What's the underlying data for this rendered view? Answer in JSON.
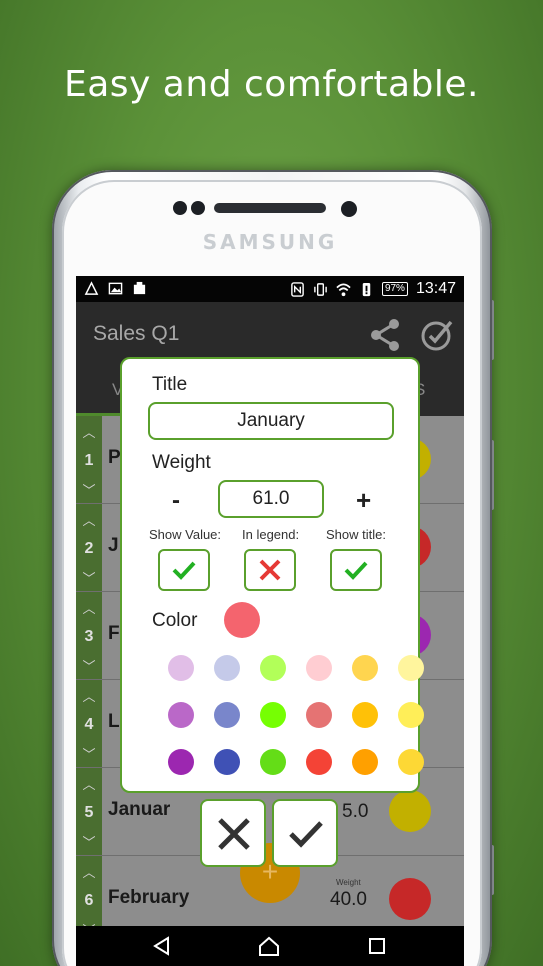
{
  "headline": "Easy and comfortable.",
  "device": {
    "brand": "SAMSUNG"
  },
  "statusbar": {
    "battery": "97%",
    "time": "13:47"
  },
  "appbar": {
    "title": "Sales Q1",
    "icons": [
      "share-icon",
      "target-check-icon"
    ]
  },
  "tabs": {
    "first_partial": "V",
    "second_partial": "S"
  },
  "list": {
    "weight_label": "Weight",
    "rows": [
      {
        "index": "1",
        "name": "P",
        "weight": "",
        "color": "#c2b000"
      },
      {
        "index": "2",
        "name": "J",
        "weight": "",
        "color": "#c62828"
      },
      {
        "index": "3",
        "name": "F",
        "weight": "",
        "color": "#9c27b0"
      },
      {
        "index": "4",
        "name": "L",
        "weight": "",
        "color": ""
      },
      {
        "index": "5",
        "name": "Januar",
        "weight": "5.0",
        "color": "#c2b000"
      },
      {
        "index": "6",
        "name": "February",
        "weight": "40.0",
        "color": "#c62828"
      }
    ],
    "fab_label": "+"
  },
  "dialog": {
    "title_label": "Title",
    "title_value": "January",
    "weight_label": "Weight",
    "minus_label": "-",
    "plus_label": "+",
    "weight_value": "61.0",
    "show_value_label": "Show Value:",
    "show_value_checked": true,
    "in_legend_label": "In legend:",
    "in_legend_checked": false,
    "show_title_label": "Show title:",
    "show_title_checked": true,
    "color_label": "Color",
    "selected_color": "#f4646e",
    "palette": [
      [
        "#e1bee7",
        "#c5cae9",
        "#b2ff59",
        "#ffcdd2",
        "#ffd54f",
        "#fff59d"
      ],
      [
        "#ba68c8",
        "#7986cb",
        "#76ff03",
        "#e57373",
        "#ffc107",
        "#ffee58"
      ],
      [
        "#9c27b0",
        "#3f51b5",
        "#64dd17",
        "#f44336",
        "#ffa000",
        "#fdd835"
      ]
    ],
    "cancel_icon": "close-icon",
    "confirm_icon": "check-icon"
  }
}
